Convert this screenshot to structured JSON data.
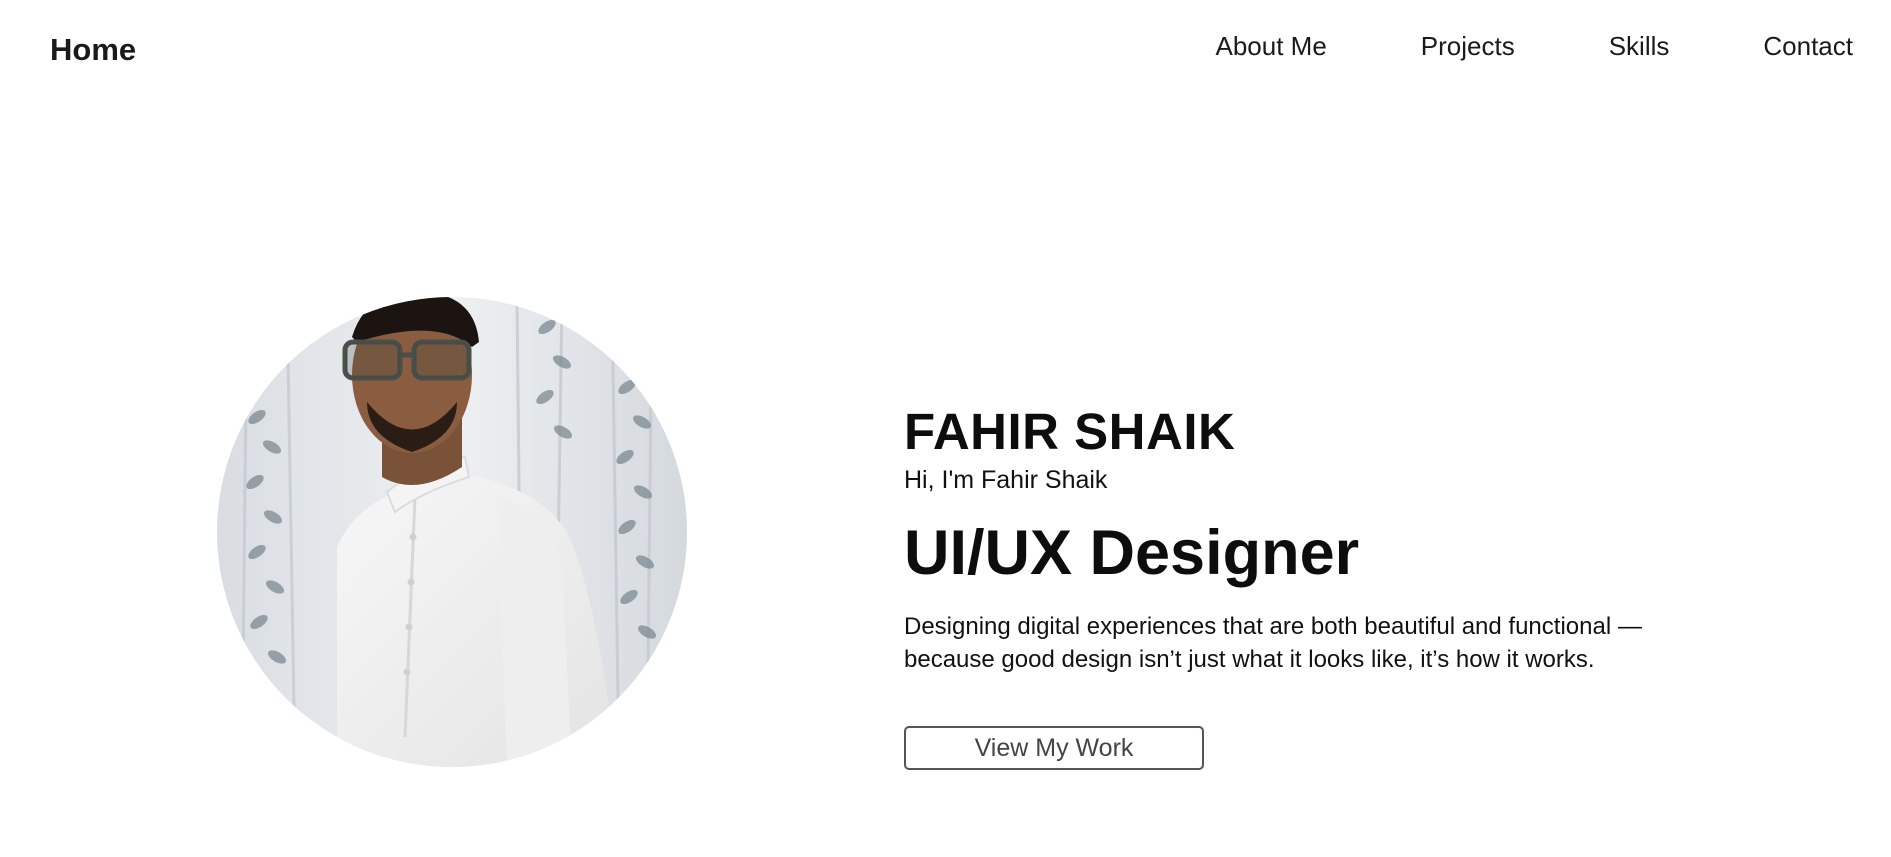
{
  "nav": {
    "brand": "Home",
    "links": [
      "About Me",
      "Projects",
      "Skills",
      "Contact"
    ]
  },
  "hero": {
    "name": "FAHIR SHAIK",
    "greeting": "Hi, I'm Fahir Shaik",
    "role": "UI/UX Designer",
    "description_lines": [
      "Designing digital experiences that are both beautiful and functional —",
      "because good design isn’t just what it looks like, it’s how it works."
    ],
    "cta_label": "View My Work"
  },
  "colors": {
    "background": "#ffffff",
    "text": "#111111",
    "button_border": "#555555",
    "button_text": "#444444"
  }
}
